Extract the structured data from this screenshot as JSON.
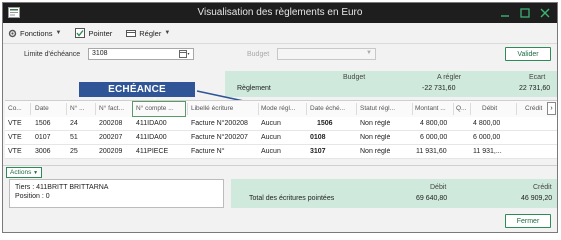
{
  "window": {
    "title": "Visualisation des règlements en Euro"
  },
  "toolbar": {
    "fonctions_label": "Fonctions",
    "pointer_label": "Pointer",
    "regler_label": "Régler"
  },
  "filter": {
    "limite_label": "Limite d'échéance",
    "limite_value": "3108",
    "budget_label": "Budget",
    "valider_label": "Valider"
  },
  "summary": {
    "budget_header": "Budget",
    "a_regler_header": "A régler",
    "ecart_header": "Ecart",
    "row_label": "Règlement",
    "a_regler_value": "-22 731,60",
    "ecart_value": "22 731,60"
  },
  "annotation": {
    "text": "ECHÉANCE DÉPASSÉE"
  },
  "columns": [
    "Co...",
    "Date",
    "N° ...",
    "N° fact...",
    "N° compte ...",
    "Libellé écriture",
    "Mode régl...",
    "Date éché...",
    "Statut régl...",
    "Montant ...",
    "Q...",
    "Débit",
    "Crédit"
  ],
  "rows": [
    {
      "co": "VTE",
      "date": "1506",
      "n": "24",
      "fact": "200208",
      "compte": "411IDA00",
      "libelle": "Facture N°200208",
      "mode": "Aucun",
      "echeance": "1506",
      "statut": "Non réglé",
      "montant": "4 800,00",
      "debit": "4 800,00"
    },
    {
      "co": "VTE",
      "date": "0107",
      "n": "51",
      "fact": "200207",
      "compte": "411IDA00",
      "libelle": "Facture N°200207",
      "mode": "Aucun",
      "echeance": "0108",
      "statut": "Non réglé",
      "montant": "6 000,00",
      "debit": "6 000,00"
    },
    {
      "co": "VTE",
      "date": "3006",
      "n": "25",
      "fact": "200209",
      "compte": "411PIECE",
      "libelle": "Facture N°",
      "mode": "Aucun",
      "echeance": "3107",
      "statut": "Non réglé",
      "montant": "11 931,60",
      "debit": "11 931,..."
    }
  ],
  "actions_label": "Actions",
  "tiers": {
    "line1": "Tiers : 411BRITT BRITTARNA",
    "line2": "Position : 0"
  },
  "totals": {
    "label": "Total des écritures pointées",
    "debit_header": "Débit",
    "credit_header": "Crédit",
    "debit_value": "69 640,80",
    "credit_value": "46 909,20"
  },
  "fermer_label": "Fermer",
  "colors": {
    "accent_green": "#2e8b57",
    "summary_bg": "#cfeadd",
    "annotation_bg": "#2f5597"
  }
}
